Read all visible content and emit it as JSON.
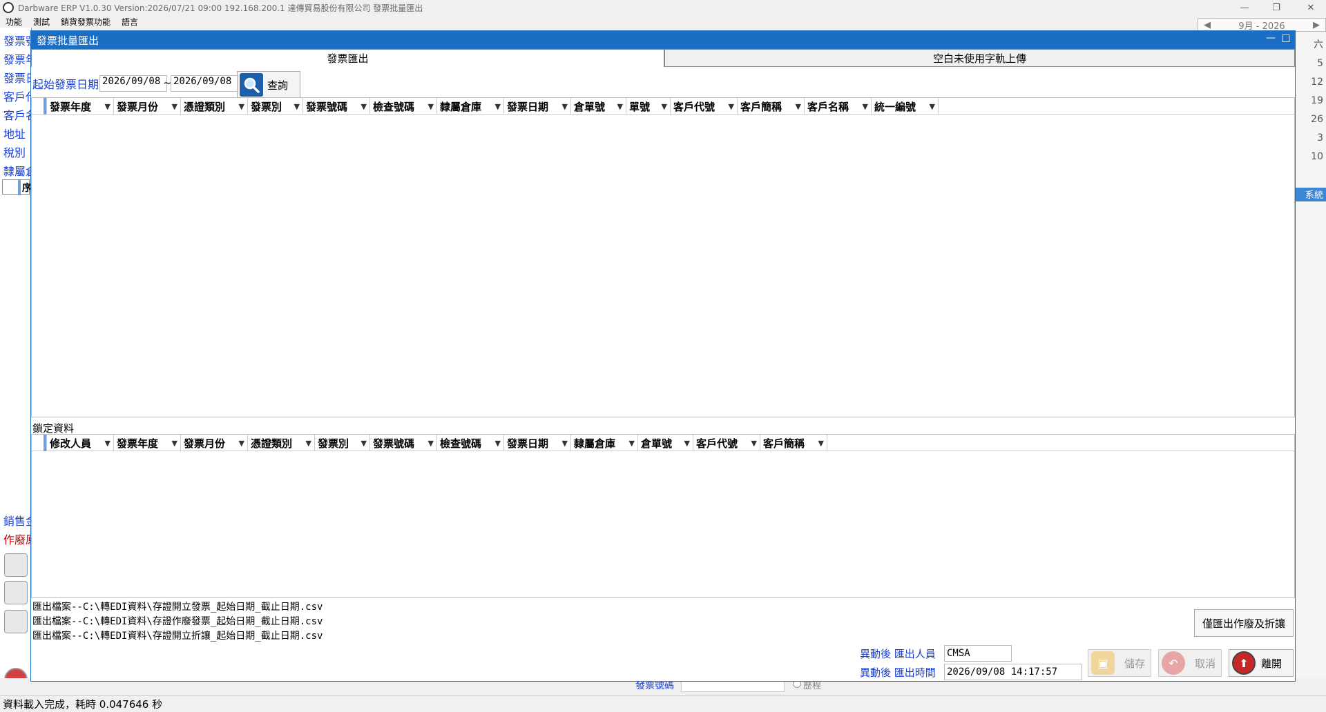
{
  "app": {
    "title": "Darbware ERP V1.0.30 Version:2026/07/21 09:00   192.168.200.1 達傳貿易股份有限公司 發票批量匯出",
    "menu": [
      "功能",
      "測試",
      "銷貨發票功能",
      "語言"
    ],
    "minimize": "—",
    "restore": "❐",
    "close": "✕"
  },
  "background": {
    "left_labels": [
      "發票號",
      "發票年",
      "發票日",
      "客戶代",
      "客戶名",
      "地址",
      "稅別",
      "隸屬倉"
    ],
    "left_grid_col": "序",
    "left_bottom_labels": [
      "銷售金",
      "作廢原"
    ],
    "calendar_header": "9月 - 2026",
    "calendar_prev": "◀",
    "calendar_next": "▶",
    "calendar_col": [
      "六",
      "5",
      "12",
      "19",
      "26",
      "3",
      "10"
    ],
    "system_btn": "系統",
    "bottom_field_label": "發票號碼",
    "bottom_radio_label": "歷程"
  },
  "modal": {
    "title": "發票批量匯出",
    "minimize": "—",
    "maximize": "□",
    "tabs": [
      {
        "label": "發票匯出",
        "active": true
      },
      {
        "label": "空白未使用字軌上傳",
        "active": false
      }
    ],
    "query": {
      "label": "起始發票日期",
      "start_date": "2026/09/08",
      "tilde": "~",
      "end_date": "2026/09/08",
      "button": "查詢"
    },
    "grid1_columns": [
      "發票年度",
      "發票月份",
      "憑證類別",
      "發票別",
      "發票號碼",
      "檢查號碼",
      "隸屬倉庫",
      "發票日期",
      "倉單號",
      "單號",
      "客戶代號",
      "客戶簡稱",
      "客戶名稱",
      "統一編號"
    ],
    "lock_label": "鎖定資料",
    "grid2_columns": [
      "修改人員",
      "發票年度",
      "發票月份",
      "憑證類別",
      "發票別",
      "發票號碼",
      "檢查號碼",
      "發票日期",
      "隸屬倉庫",
      "倉單號",
      "客戶代號",
      "客戶簡稱"
    ],
    "export_lines": [
      "匯出檔案--C:\\轉EDI資料\\存證開立發票_起始日期_截止日期.csv",
      "匯出檔案--C:\\轉EDI資料\\存證作廢發票_起始日期_截止日期.csv",
      "匯出檔案--C:\\轉EDI資料\\存證開立折讓_起始日期_截止日期.csv"
    ],
    "only_export_button": "僅匯出作廢及折讓",
    "meta": {
      "user_label_prefix": "異動後",
      "user_label": "匯出人員",
      "user_value": "CMSA",
      "time_label_prefix": "異動後",
      "time_label": "匯出時間",
      "time_value": "2026/09/08  14:17:57"
    },
    "buttons": {
      "save": "儲存",
      "cancel": "取消",
      "leave": "離開"
    }
  },
  "status": {
    "text": "資料載入完成，耗時 0.047646 秒"
  },
  "colors": {
    "title_blue": "#1a6fc4",
    "label_blue": "#1a3fd0",
    "label_red": "#c00000"
  }
}
